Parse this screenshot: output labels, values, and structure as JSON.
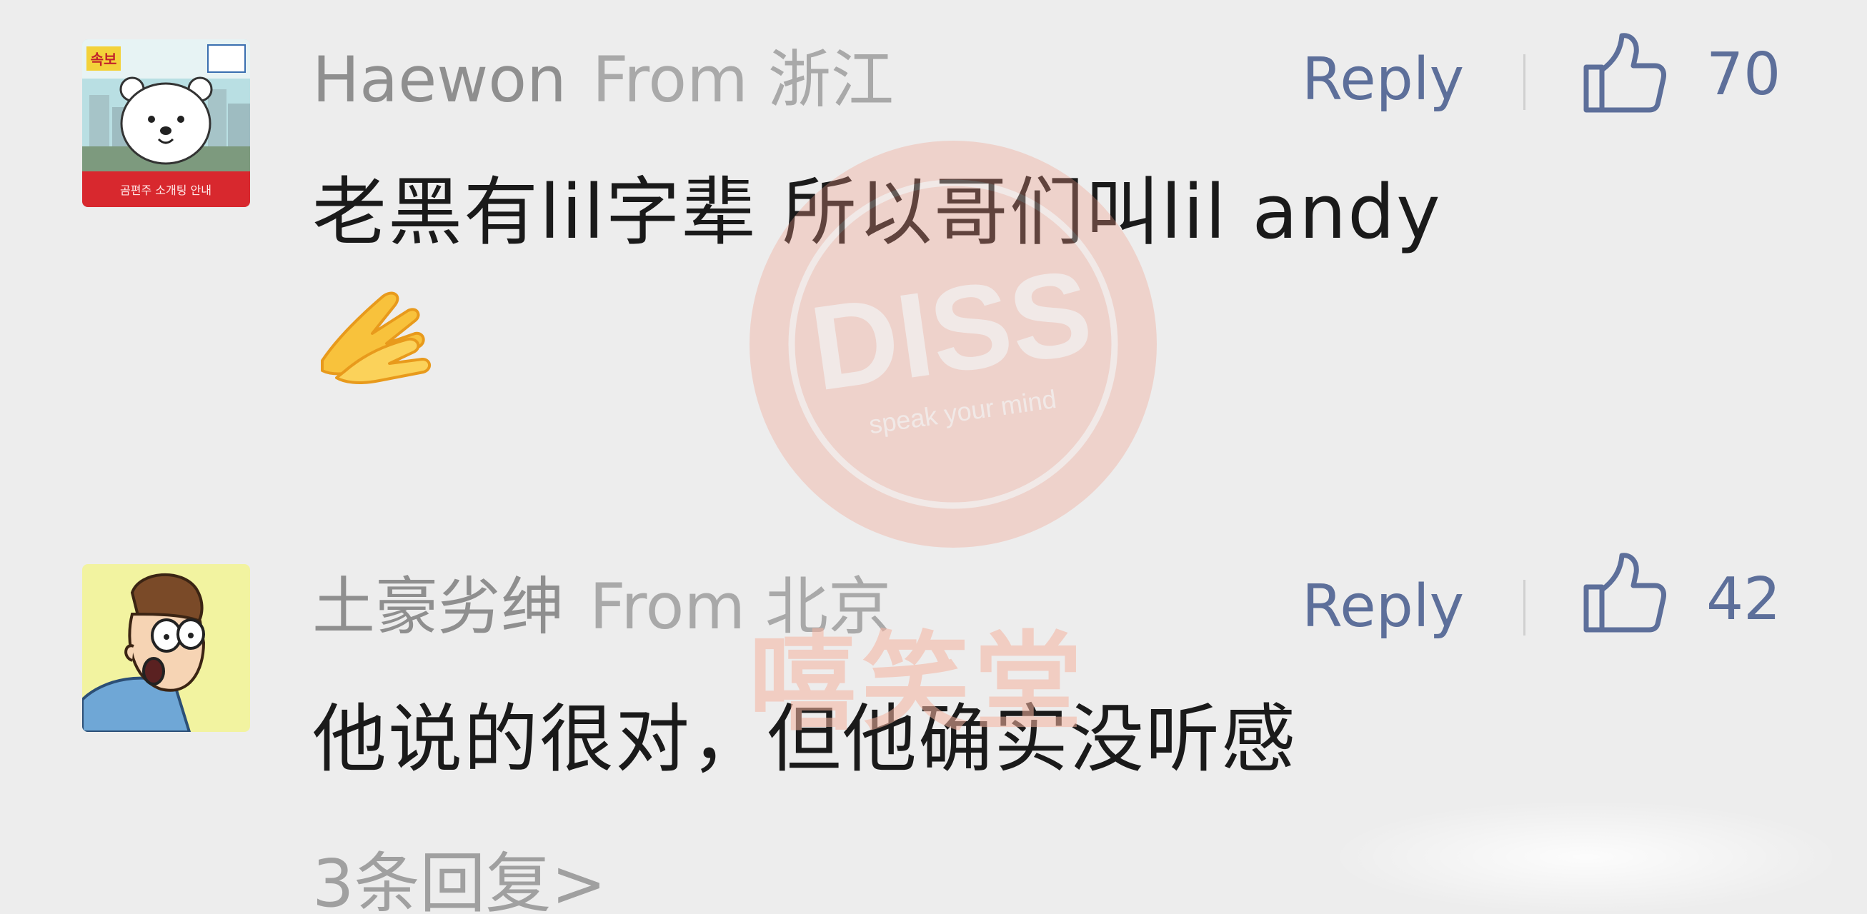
{
  "comments": [
    {
      "username": "Haewon",
      "location": "From 浙江",
      "reply_label": "Reply",
      "like_count": "70",
      "text": "老黑有lil字辈 所以哥们叫lil andy",
      "emoji": "clapping-hands",
      "avatar": "bear-avatar",
      "avatar_badge": "속보",
      "avatar_banner": "곰편주 소개팅 안내"
    },
    {
      "username": "土豪劣绅",
      "location": "From 北京",
      "reply_label": "Reply",
      "like_count": "42",
      "text": "他说的很对，但他确实没听感",
      "avatar": "cartoon-man-avatar"
    }
  ],
  "more_replies": "3条回复>",
  "watermark": {
    "logo_text": "DISS",
    "logo_tagline": "speak your mind",
    "text": "嘻笑堂"
  },
  "colors": {
    "background": "#ededed",
    "accent": "#5d6f9a",
    "username": "#8f8f8f",
    "body": "#1a1a1a"
  }
}
